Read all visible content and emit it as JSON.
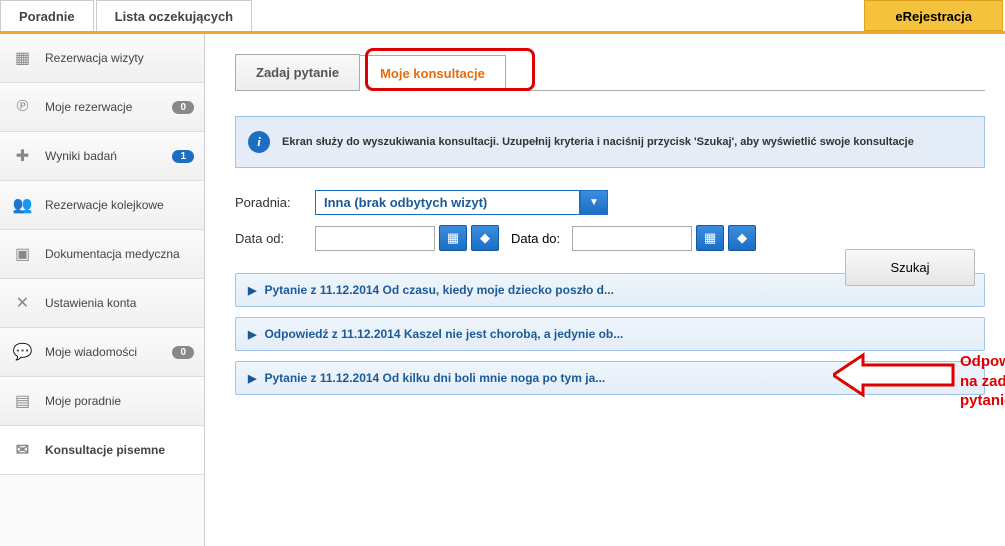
{
  "topTabs": {
    "poradnie": "Poradnie",
    "lista": "Lista oczekujących",
    "erej": "eRejestracja"
  },
  "sidebar": {
    "items": [
      {
        "label": "Rezerwacja wizyty"
      },
      {
        "label": "Moje rezerwacje",
        "badge": "0"
      },
      {
        "label": "Wyniki badań",
        "badge": "1",
        "blue": true
      },
      {
        "label": "Rezerwacje kolejkowe"
      },
      {
        "label": "Dokumentacja medyczna"
      },
      {
        "label": "Ustawienia konta"
      },
      {
        "label": "Moje wiadomości",
        "badge": "0"
      },
      {
        "label": "Moje poradnie"
      },
      {
        "label": "Konsultacje pisemne"
      }
    ]
  },
  "innerTabs": {
    "zadaj": "Zadaj pytanie",
    "moje": "Moje konsultacje"
  },
  "info": "Ekran służy do wyszukiwania konsultacji. Uzupełnij kryteria i naciśnij przycisk 'Szukaj', aby wyświetlić swoje konsultacje",
  "filter": {
    "poradniaLabel": "Poradnia:",
    "poradniaValue": "Inna (brak odbytych wizyt)",
    "dataOdLabel": "Data od:",
    "dataOdValue": "",
    "dataDoLabel": "Data do:",
    "dataDoValue": "",
    "searchLabel": "Szukaj"
  },
  "results": [
    "Pytanie z 11.12.2014 Od czasu, kiedy moje dziecko poszło d...",
    "Odpowiedź z 11.12.2014 Kaszel nie jest chorobą, a jedynie ob...",
    "Pytanie z 11.12.2014 Od kilku dni boli mnie noga po tym ja..."
  ],
  "annotation": "Odpowiedź na zadane pytanie"
}
